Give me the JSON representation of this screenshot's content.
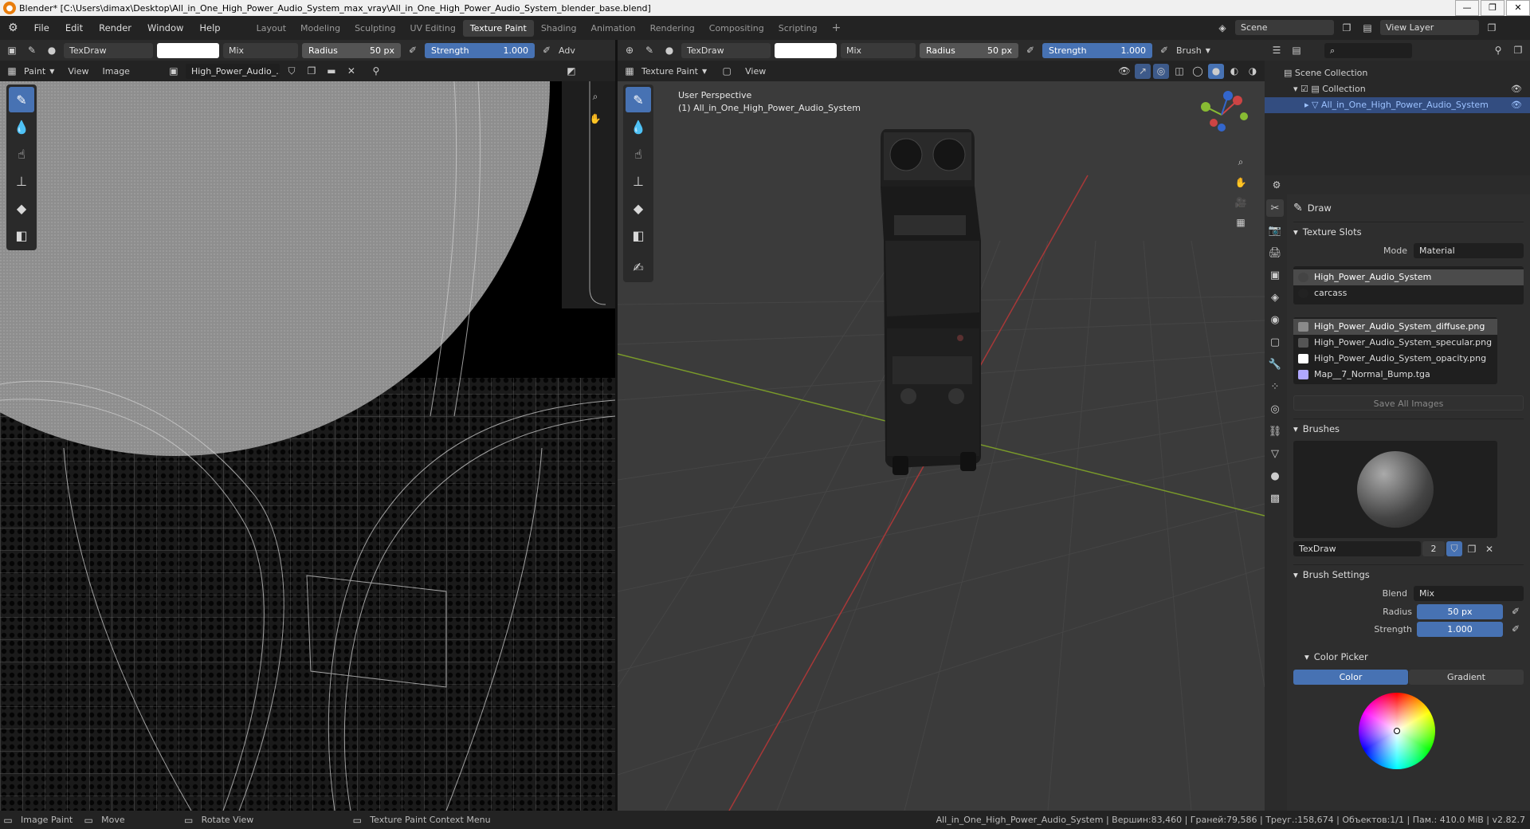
{
  "window": {
    "title": "Blender* [C:\\Users\\dimax\\Desktop\\All_in_One_High_Power_Audio_System_max_vray\\All_in_One_High_Power_Audio_System_blender_base.blend]",
    "minimize": "—",
    "maximize": "❐",
    "close": "✕"
  },
  "menu": [
    "File",
    "Edit",
    "Render",
    "Window",
    "Help"
  ],
  "workspaces": [
    "Layout",
    "Modeling",
    "Sculpting",
    "UV Editing",
    "Texture Paint",
    "Shading",
    "Animation",
    "Rendering",
    "Compositing",
    "Scripting"
  ],
  "active_workspace": "Texture Paint",
  "scene": {
    "name": "Scene",
    "view_layer": "View Layer"
  },
  "left_header": {
    "brush": "TexDraw",
    "blend": "Mix",
    "radius_label": "Radius",
    "radius_value": "50 px",
    "strength_label": "Strength",
    "strength_value": "1.000",
    "adv": "Adv"
  },
  "left_sub": {
    "mode": "Paint",
    "view": "View",
    "image": "Image",
    "image_name": "High_Power_Audio_..."
  },
  "mid_header": {
    "brush": "TexDraw",
    "blend": "Mix",
    "radius_label": "Radius",
    "radius_value": "50 px",
    "strength_label": "Strength",
    "strength_value": "1.000",
    "brush_menu": "Brush"
  },
  "mid_sub": {
    "mode": "Texture Paint",
    "view": "View"
  },
  "viewport": {
    "perspective": "User Perspective",
    "object": "(1) All_in_One_High_Power_Audio_System"
  },
  "outliner": {
    "root": "Scene Collection",
    "collection": "Collection",
    "object": "All_in_One_High_Power_Audio_System"
  },
  "props": {
    "tool_name": "Draw",
    "texture_slots": "Texture Slots",
    "mode_label": "Mode",
    "mode_value": "Material",
    "materials": [
      "High_Power_Audio_System",
      "carcass"
    ],
    "images": [
      {
        "name": "High_Power_Audio_System_diffuse.png",
        "color": "#8a8a8a"
      },
      {
        "name": "High_Power_Audio_System_specular.png",
        "color": "#555555"
      },
      {
        "name": "High_Power_Audio_System_opacity.png",
        "color": "#ffffff"
      },
      {
        "name": "Map__7_Normal_Bump.tga",
        "color": "#b0a8ff"
      }
    ],
    "save_all": "Save All Images",
    "brushes": "Brushes",
    "brush_name": "TexDraw",
    "brush_users": "2",
    "brush_settings": "Brush Settings",
    "blend_label": "Blend",
    "blend_value": "Mix",
    "radius_label": "Radius",
    "radius_value": "50 px",
    "strength_label": "Strength",
    "strength_value": "1.000",
    "color_picker": "Color Picker",
    "color_tab": "Color",
    "gradient_tab": "Gradient"
  },
  "status": {
    "image_paint": "Image Paint",
    "move": "Move",
    "rotate": "Rotate View",
    "context": "Texture Paint Context Menu",
    "stats": "All_in_One_High_Power_Audio_System | Вершин:83,460 | Граней:79,586 | Треуг.:158,674 | Объектов:1/1 | Пам.: 410.0 MiB | v2.82.7"
  }
}
